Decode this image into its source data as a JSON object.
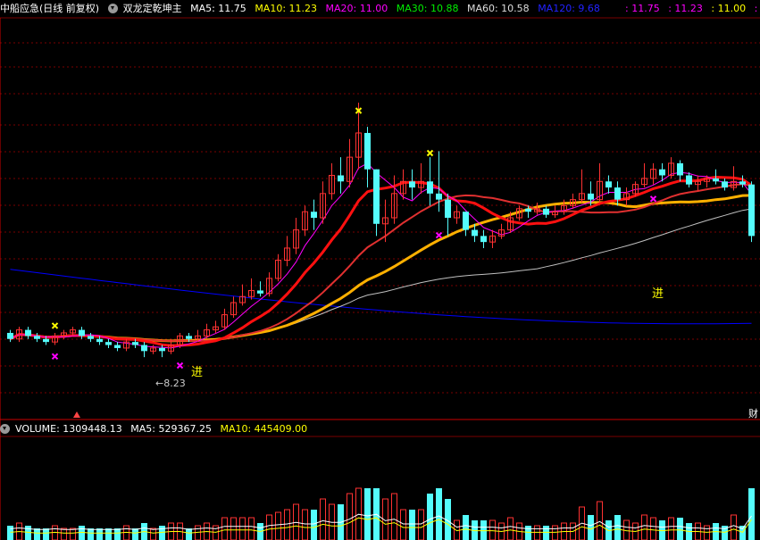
{
  "header": {
    "stock_name": "中船应急",
    "period": "(日线 前复权)",
    "indicator": "双龙定乾坤主",
    "ma5": "MA5: 11.75",
    "ma10": "MA10: 11.23",
    "ma20": "MA20: 11.00",
    "ma30": "MA30: 10.88",
    "ma60": "MA60: 10.58",
    "ma120": "MA120: 9.68",
    "right_ma5": ": 11.75",
    "right_ma10": ": 11.23",
    "right_ma20": ": 11.00",
    "right_cut": ": 1"
  },
  "volume_header": {
    "volume": "VOLUME: 1309448.13",
    "ma5": "MA5: 529367.25",
    "ma10": "MA10: 445409.00"
  },
  "annotations": {
    "low_label": "←8.23",
    "signal_1": "进",
    "signal_2": "进",
    "edge_label": "财"
  },
  "colors": {
    "up": "#ff3232",
    "down": "#54fcfc",
    "ma5": "#ffffff",
    "ma10": "#ffff00",
    "ma20": "#ff00ff",
    "ma30": "#00e000",
    "ma60": "#c0c0c0",
    "ma120": "#0000ff",
    "grid": "#7a0000"
  },
  "chart_data": {
    "type": "candlestick",
    "candles": [
      [
        10.0,
        9.9,
        10.05,
        9.85
      ],
      [
        9.9,
        10.05,
        10.1,
        9.85
      ],
      [
        10.05,
        9.95,
        10.1,
        9.9
      ],
      [
        9.95,
        9.9,
        10.0,
        9.85
      ],
      [
        9.9,
        9.85,
        9.95,
        9.8
      ],
      [
        9.85,
        9.95,
        10.0,
        9.8
      ],
      [
        9.95,
        10.0,
        10.05,
        9.9
      ],
      [
        10.0,
        10.05,
        10.1,
        9.95
      ],
      [
        10.05,
        9.95,
        10.1,
        9.9
      ],
      [
        9.95,
        9.9,
        10.0,
        9.85
      ],
      [
        9.9,
        9.85,
        9.95,
        9.8
      ],
      [
        9.85,
        9.8,
        9.9,
        9.75
      ],
      [
        9.8,
        9.75,
        9.85,
        9.7
      ],
      [
        9.75,
        9.85,
        9.9,
        9.7
      ],
      [
        9.85,
        9.8,
        9.9,
        9.75
      ],
      [
        9.8,
        9.7,
        9.85,
        9.6
      ],
      [
        9.7,
        9.75,
        9.8,
        9.65
      ],
      [
        9.75,
        9.7,
        9.8,
        9.6
      ],
      [
        9.7,
        9.8,
        9.9,
        9.65
      ],
      [
        9.8,
        9.95,
        10.0,
        9.75
      ],
      [
        9.95,
        9.9,
        10.0,
        9.85
      ],
      [
        9.9,
        9.95,
        10.05,
        9.85
      ],
      [
        9.95,
        10.05,
        10.15,
        9.9
      ],
      [
        10.05,
        10.1,
        10.2,
        10.0
      ],
      [
        10.1,
        10.3,
        10.4,
        10.05
      ],
      [
        10.3,
        10.5,
        10.6,
        10.25
      ],
      [
        10.5,
        10.6,
        10.8,
        10.45
      ],
      [
        10.6,
        10.7,
        10.9,
        10.55
      ],
      [
        10.7,
        10.65,
        10.85,
        10.6
      ],
      [
        10.65,
        10.9,
        11.0,
        10.6
      ],
      [
        10.9,
        11.2,
        11.3,
        10.85
      ],
      [
        11.2,
        11.4,
        11.6,
        11.1
      ],
      [
        11.4,
        11.7,
        11.9,
        11.3
      ],
      [
        11.7,
        12.0,
        12.1,
        11.6
      ],
      [
        12.0,
        11.9,
        12.2,
        11.7
      ],
      [
        11.9,
        12.3,
        12.5,
        11.8
      ],
      [
        12.3,
        12.6,
        12.8,
        12.2
      ],
      [
        12.6,
        12.5,
        12.9,
        12.3
      ],
      [
        12.5,
        12.9,
        13.2,
        12.4
      ],
      [
        12.9,
        13.3,
        13.8,
        12.7
      ],
      [
        13.3,
        12.7,
        13.4,
        12.4
      ],
      [
        12.7,
        11.8,
        12.7,
        11.6
      ],
      [
        11.8,
        11.9,
        12.2,
        11.5
      ],
      [
        11.9,
        12.3,
        12.6,
        11.8
      ],
      [
        12.3,
        12.5,
        12.7,
        12.2
      ],
      [
        12.5,
        12.4,
        12.7,
        12.2
      ],
      [
        12.4,
        12.5,
        12.8,
        12.3
      ],
      [
        12.5,
        12.3,
        12.9,
        12.1
      ],
      [
        12.3,
        12.2,
        13.0,
        12.0
      ],
      [
        12.2,
        11.9,
        12.3,
        11.6
      ],
      [
        11.9,
        12.0,
        12.1,
        11.8
      ],
      [
        12.0,
        11.7,
        12.0,
        11.6
      ],
      [
        11.7,
        11.6,
        11.8,
        11.5
      ],
      [
        11.6,
        11.5,
        11.7,
        11.4
      ],
      [
        11.5,
        11.6,
        11.7,
        11.4
      ],
      [
        11.6,
        11.7,
        11.8,
        11.55
      ],
      [
        11.7,
        11.9,
        12.0,
        11.65
      ],
      [
        11.9,
        12.05,
        12.1,
        11.85
      ],
      [
        12.05,
        12.0,
        12.1,
        11.9
      ],
      [
        12.0,
        12.05,
        12.15,
        11.95
      ],
      [
        12.05,
        11.95,
        12.1,
        11.9
      ],
      [
        11.95,
        12.0,
        12.1,
        11.9
      ],
      [
        12.0,
        12.1,
        12.2,
        11.95
      ],
      [
        12.1,
        12.2,
        12.3,
        12.05
      ],
      [
        12.2,
        12.3,
        12.7,
        12.15
      ],
      [
        12.3,
        12.2,
        12.5,
        12.1
      ],
      [
        12.2,
        12.5,
        12.8,
        12.15
      ],
      [
        12.5,
        12.4,
        12.6,
        12.3
      ],
      [
        12.4,
        12.2,
        12.5,
        12.1
      ],
      [
        12.2,
        12.3,
        12.4,
        12.1
      ],
      [
        12.3,
        12.45,
        12.5,
        12.25
      ],
      [
        12.45,
        12.55,
        12.8,
        12.4
      ],
      [
        12.55,
        12.7,
        12.8,
        12.45
      ],
      [
        12.7,
        12.6,
        12.8,
        12.5
      ],
      [
        12.6,
        12.8,
        12.9,
        12.55
      ],
      [
        12.8,
        12.6,
        12.85,
        12.5
      ],
      [
        12.6,
        12.45,
        12.65,
        12.4
      ],
      [
        12.45,
        12.5,
        12.6,
        12.35
      ],
      [
        12.5,
        12.55,
        12.6,
        12.4
      ],
      [
        12.55,
        12.5,
        12.7,
        12.45
      ],
      [
        12.5,
        12.4,
        12.55,
        12.35
      ],
      [
        12.4,
        12.5,
        12.75,
        12.35
      ],
      [
        12.5,
        12.45,
        12.6,
        12.4
      ],
      [
        12.45,
        11.6,
        12.5,
        11.5
      ]
    ],
    "volume_header_values": {
      "volume": 1309448.13,
      "ma5": 529367.25,
      "ma10": 445409.0
    },
    "ma_values": {
      "MA5": 11.75,
      "MA10": 11.23,
      "MA20": 11.0,
      "MA30": 10.88,
      "MA60": 10.58,
      "MA120": 9.68
    },
    "low_marker": 8.23
  }
}
